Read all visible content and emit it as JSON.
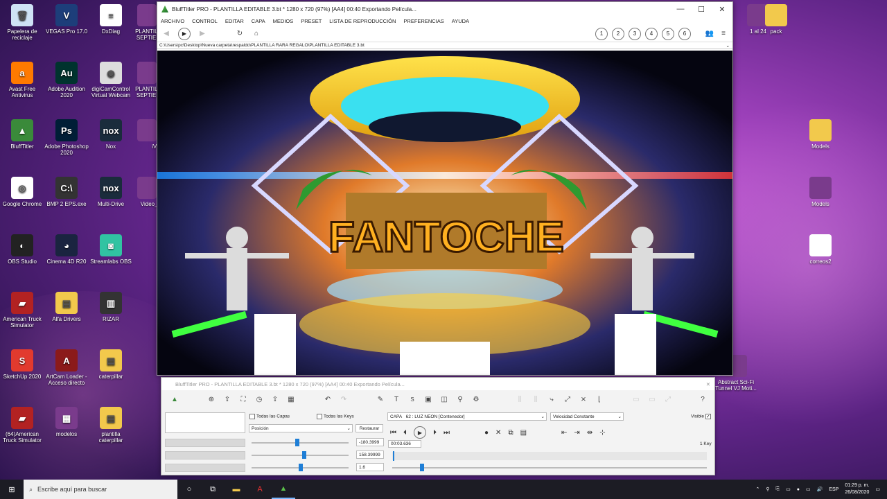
{
  "desktop": {
    "icons_left": [
      {
        "label": "Papelera de reciclaje",
        "icon": "recycle-bin-icon",
        "color": "#cfe3f5",
        "glyph": "🗑"
      },
      {
        "label": "VEGAS Pro 17.0",
        "icon": "vegas-icon",
        "color": "#1d3e7a",
        "glyph": "V"
      },
      {
        "label": "DxDiag",
        "icon": "document-icon",
        "color": "#ffffff",
        "glyph": "≡"
      },
      {
        "label": "Avast Free Antivirus",
        "icon": "avast-icon",
        "color": "#ff7a00",
        "glyph": "a"
      },
      {
        "label": "Adobe Audition 2020",
        "icon": "audition-icon",
        "color": "#00332e",
        "glyph": "Au"
      },
      {
        "label": "digiCamControl Virtual Webcam",
        "icon": "webcam-icon",
        "color": "#dddddd",
        "glyph": "◉"
      },
      {
        "label": "BluffTitler",
        "icon": "blufftitler-icon",
        "color": "#3a8a3a",
        "glyph": "▲"
      },
      {
        "label": "Adobe Photoshop 2020",
        "icon": "photoshop-icon",
        "color": "#001e36",
        "glyph": "Ps"
      },
      {
        "label": "Nox",
        "icon": "nox-icon",
        "color": "#1a2c3c",
        "glyph": "nox"
      },
      {
        "label": "Google Chrome",
        "icon": "chrome-icon",
        "color": "#ffffff",
        "glyph": "◎"
      },
      {
        "label": "BMP 2 EPS.exe",
        "icon": "terminal-icon",
        "color": "#333333",
        "glyph": "C:\\"
      },
      {
        "label": "Multi-Drive",
        "icon": "nox-multi-icon",
        "color": "#1a2c3c",
        "glyph": "nox"
      },
      {
        "label": "OBS Studio",
        "icon": "obs-icon",
        "color": "#222222",
        "glyph": "◐"
      },
      {
        "label": "Cinema 4D R20",
        "icon": "cinema4d-icon",
        "color": "#1a2440",
        "glyph": "◕"
      },
      {
        "label": "Streamlabs OBS",
        "icon": "streamlabs-icon",
        "color": "#31c3a2",
        "glyph": "◙"
      },
      {
        "label": "American Truck Simulator",
        "icon": "truck-icon",
        "color": "#b22222",
        "glyph": "▰"
      },
      {
        "label": "Alfa Drivers",
        "icon": "folder-icon",
        "color": "#f2c94c",
        "glyph": "▤"
      },
      {
        "label": "RIZAR",
        "icon": "archive-icon",
        "color": "#333333",
        "glyph": "▥"
      },
      {
        "label": "SketchUp 2020",
        "icon": "sketchup-icon",
        "color": "#e23a2e",
        "glyph": "S"
      },
      {
        "label": "ArtCam Loader - Acceso directo",
        "icon": "artcam-icon",
        "color": "#8b1a1a",
        "glyph": "A"
      },
      {
        "label": "caterpillar",
        "icon": "folder-icon",
        "color": "#f2c94c",
        "glyph": "▤"
      },
      {
        "label": "(64)American Truck Simulator",
        "icon": "truck-icon",
        "color": "#b22222",
        "glyph": "▰"
      },
      {
        "label": "modelos",
        "icon": "winrar-icon",
        "color": "#7a3b8c",
        "glyph": "▦"
      },
      {
        "label": "plantilla caterpillar",
        "icon": "folder-icon",
        "color": "#f2c94c",
        "glyph": "▤"
      }
    ],
    "icons_partial": [
      {
        "label": "PLANTILL SEPTIEM",
        "icon": "winrar-icon"
      },
      {
        "label": "PLANTILL SEPTIEM",
        "icon": "winrar-icon"
      },
      {
        "label": "iVC",
        "icon": "ivcam-icon"
      },
      {
        "label": "Video_2",
        "icon": "document-icon"
      }
    ],
    "icons_right": [
      {
        "label": "1 al 24",
        "icon": "winrar-icon"
      },
      {
        "label": "pack",
        "icon": "folder-icon"
      },
      {
        "label": "Models",
        "icon": "folder-icon"
      },
      {
        "label": "Models",
        "icon": "winrar-icon"
      },
      {
        "label": "correos2",
        "icon": "document-icon"
      },
      {
        "label": "Abstract Sci-Fi Tunnel VJ Moti...",
        "icon": "winrar-icon"
      }
    ]
  },
  "main_window": {
    "title": "BluffTitler PRO  -  PLANTILLA EDITABLE 3.bt * 1280 x 720 (97%) [AA4] 00:40 Exportando Película...",
    "menu": [
      "ARCHIVO",
      "CONTROL",
      "EDITAR",
      "CAPA",
      "MEDIOS",
      "PRESET",
      "LISTA DE REPRODUCCIÓN",
      "PREFERENCIAS",
      "AYUDA"
    ],
    "path": "C:\\Users\\pc\\Desktop\\Nueva carpeta\\respaldo\\PLANTILLA RARA REGALO\\PLANTILLA EDITABLE 3.bt",
    "badges": [
      "1",
      "2",
      "3",
      "4",
      "5",
      "6"
    ],
    "preview_logo": "FANTOCHE"
  },
  "timeline_window": {
    "title": "BluffTitler PRO  -  PLANTILLA EDITABLE 3.bt * 1280 x 720 (97%) [AA4] 00:40 Exportando Película...",
    "todas_capas": "Todas las Capas",
    "todas_keys": "Todas las Keys",
    "property": "Posición",
    "restore": "Restaurar",
    "layer_label": "CAPA",
    "layer_num": "62",
    "layer_name": ": LUZ NEON [Contenedor]",
    "speed": "Velocidad Constante",
    "visible": "Visible",
    "time": "00:03.636",
    "value_x": "-180.3999",
    "value_y": "158.39999",
    "value_z": "1.6",
    "keys": "1 Key",
    "tool_t": "T",
    "tool_s": "S"
  },
  "taskbar": {
    "search_placeholder": "Escribe aquí para buscar",
    "lang": "ESP",
    "time": "01:29 p. m.",
    "date": "26/08/2020"
  }
}
